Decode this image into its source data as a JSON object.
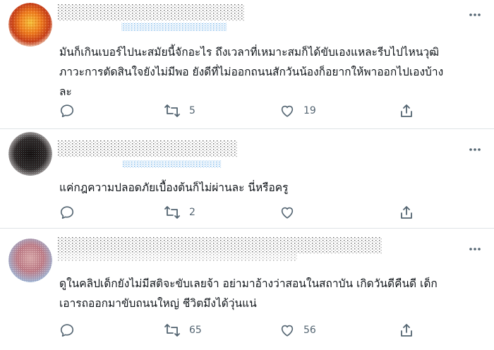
{
  "tweets": [
    {
      "lines": [
        "มันก็เกินเบอร์ไปนะสมัยนี้จักอะไร ถึงเวลาที่เหมาะสมก็ได้ขับเองแหละรีบไปไหนวุฒิ",
        "ภาวะการตัดสินใจยังไม่มีพอ ยังดีที่ไม่ออกถนนสักวันน้องก็อยากให้พาออกไปเองบ้าง",
        "ละ"
      ],
      "replies": "",
      "retweets": "5",
      "likes": "19",
      "avatar_color": "#e0641e"
    },
    {
      "lines": [
        "แค่กฎความปลอดภัยเบื้องต้นก็ไม่ผ่านละ นี่หรือครู"
      ],
      "replies": "",
      "retweets": "2",
      "likes": "",
      "avatar_color": "#222222"
    },
    {
      "lines": [
        "ดูในคลิปเด็กยังไม่มีสติจะขับเลยจ้า อย่ามาอ้างว่าสอนในสถาบัน เกิดวันดีคืนดี เด็ก",
        "เอารถออกมาขับถนนใหญ่ ชีวิตมึงได้วุ่นแน่"
      ],
      "replies": "",
      "retweets": "65",
      "likes": "56",
      "avatar_color": "#c98a8a"
    }
  ],
  "colors": {
    "text": "#0f1419",
    "muted": "#536471",
    "divider": "#dfe3e6",
    "link_redact": "#1d9bf0"
  },
  "icons": [
    "reply-icon",
    "retweet-icon",
    "like-icon",
    "share-icon",
    "more-icon"
  ]
}
